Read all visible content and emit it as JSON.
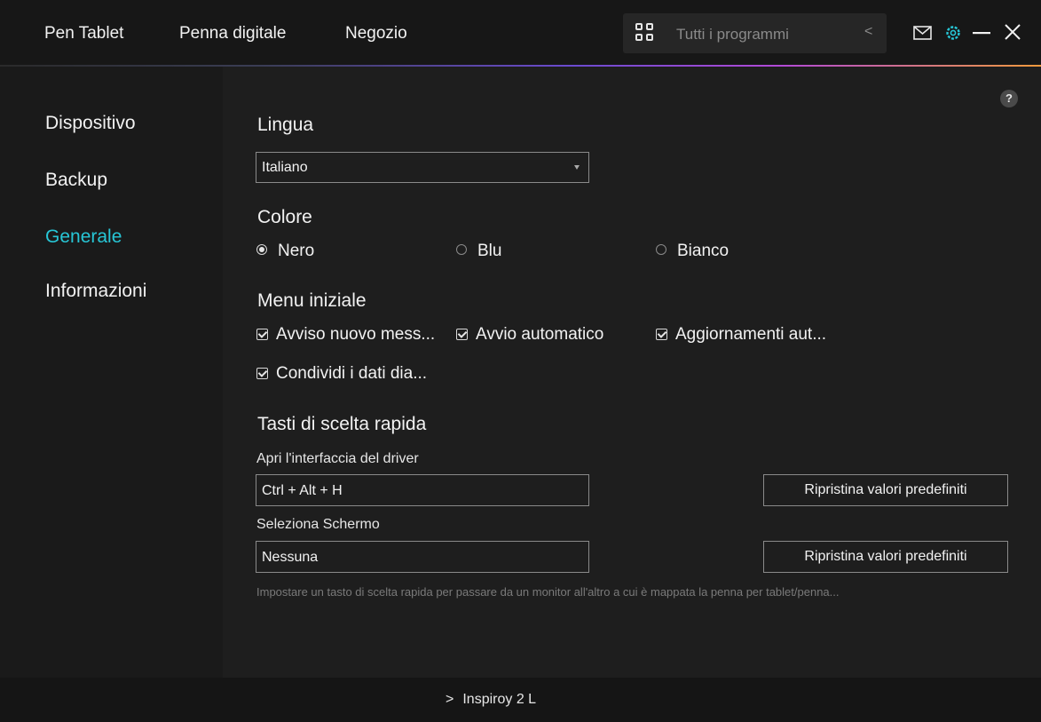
{
  "topbar": {
    "nav": [
      "Pen Tablet",
      "Penna digitale",
      "Negozio"
    ],
    "program_select": "Tutti i programmi"
  },
  "sidebar": {
    "items": [
      {
        "label": "Dispositivo"
      },
      {
        "label": "Backup"
      },
      {
        "label": "Generale",
        "active": true
      },
      {
        "label": "Informazioni"
      }
    ]
  },
  "main": {
    "help": "?",
    "language": {
      "title": "Lingua",
      "value": "Italiano"
    },
    "color": {
      "title": "Colore",
      "options": [
        {
          "label": "Nero",
          "selected": true
        },
        {
          "label": "Blu",
          "selected": false
        },
        {
          "label": "Bianco",
          "selected": false
        }
      ]
    },
    "startup": {
      "title": "Menu iniziale",
      "options": [
        {
          "label": "Avviso nuovo mess...",
          "checked": true
        },
        {
          "label": "Avvio automatico",
          "checked": true
        },
        {
          "label": "Aggiornamenti aut...",
          "checked": true
        },
        {
          "label": "Condividi i dati dia...",
          "checked": true
        }
      ]
    },
    "shortcuts": {
      "title": "Tasti di scelta rapida",
      "driver_label": "Apri l'interfaccia del driver",
      "driver_value": "Ctrl + Alt + H",
      "screen_label": "Seleziona Schermo",
      "screen_value": "Nessuna",
      "reset_label": "Ripristina valori predefiniti",
      "hint": "Impostare un tasto di scelta rapida per passare da un monitor all'altro a cui è mappata la penna per tablet/penna..."
    }
  },
  "bottombar": {
    "device": "Inspiroy 2 L"
  },
  "colors": {
    "accent": "#27c6d6",
    "background": "#1e1e1e",
    "sidebar": "#1a1a1a"
  }
}
